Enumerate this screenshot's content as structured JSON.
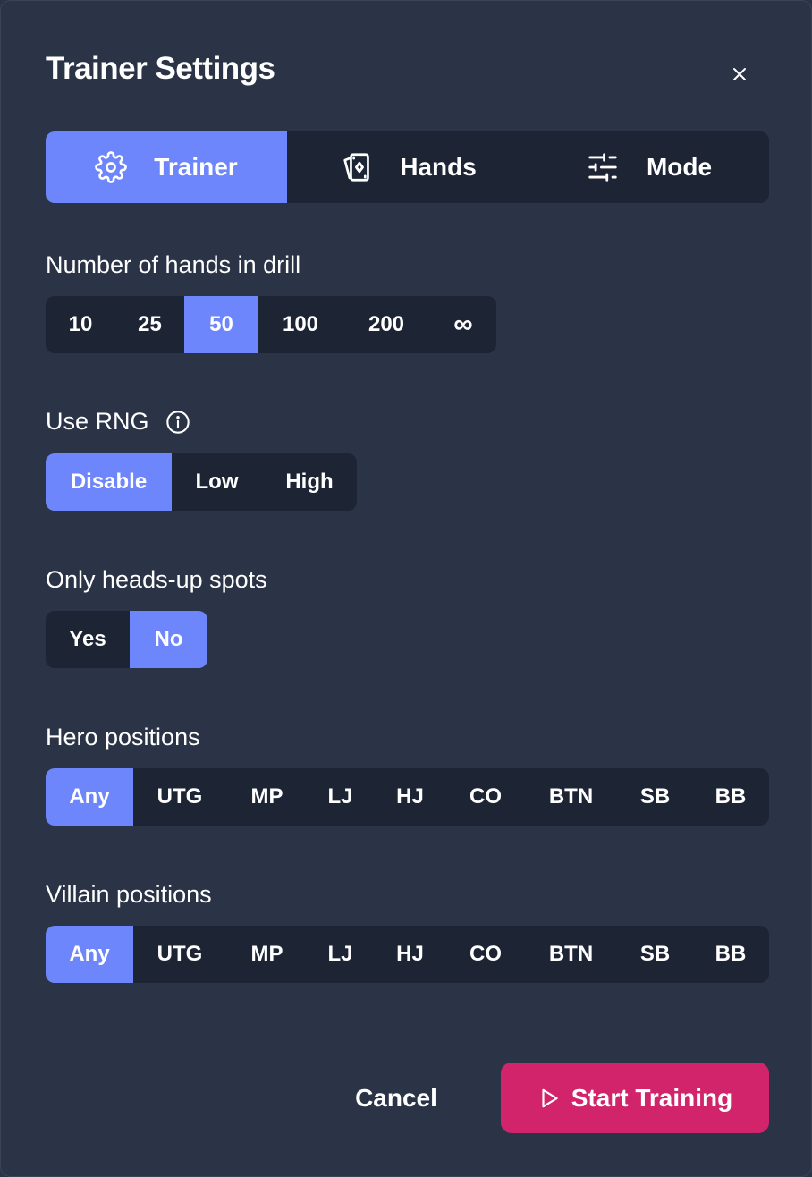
{
  "dialog": {
    "title": "Trainer Settings",
    "close_icon": "close-icon"
  },
  "tabs": [
    {
      "label": "Trainer",
      "icon": "gear-icon",
      "active": true
    },
    {
      "label": "Hands",
      "icon": "cards-icon",
      "active": false
    },
    {
      "label": "Mode",
      "icon": "sliders-icon",
      "active": false
    }
  ],
  "hands_in_drill": {
    "label": "Number of hands in drill",
    "options": [
      "10",
      "25",
      "50",
      "100",
      "200",
      "∞"
    ],
    "selected": "50"
  },
  "rng": {
    "label": "Use RNG",
    "info_icon": "info-icon",
    "options": [
      "Disable",
      "Low",
      "High"
    ],
    "selected": "Disable"
  },
  "heads_up": {
    "label": "Only heads-up spots",
    "options": [
      "Yes",
      "No"
    ],
    "selected": "No"
  },
  "hero_positions": {
    "label": "Hero positions",
    "options": [
      "Any",
      "UTG",
      "MP",
      "LJ",
      "HJ",
      "CO",
      "BTN",
      "SB",
      "BB"
    ],
    "selected": "Any"
  },
  "villain_positions": {
    "label": "Villain positions",
    "options": [
      "Any",
      "UTG",
      "MP",
      "LJ",
      "HJ",
      "CO",
      "BTN",
      "SB",
      "BB"
    ],
    "selected": "Any"
  },
  "footer": {
    "cancel_label": "Cancel",
    "start_label": "Start Training",
    "start_icon": "play-icon"
  },
  "colors": {
    "background": "#2b3447",
    "segment_bg": "#1d2535",
    "accent": "#6e86fb",
    "primary_button": "#d1246a"
  }
}
